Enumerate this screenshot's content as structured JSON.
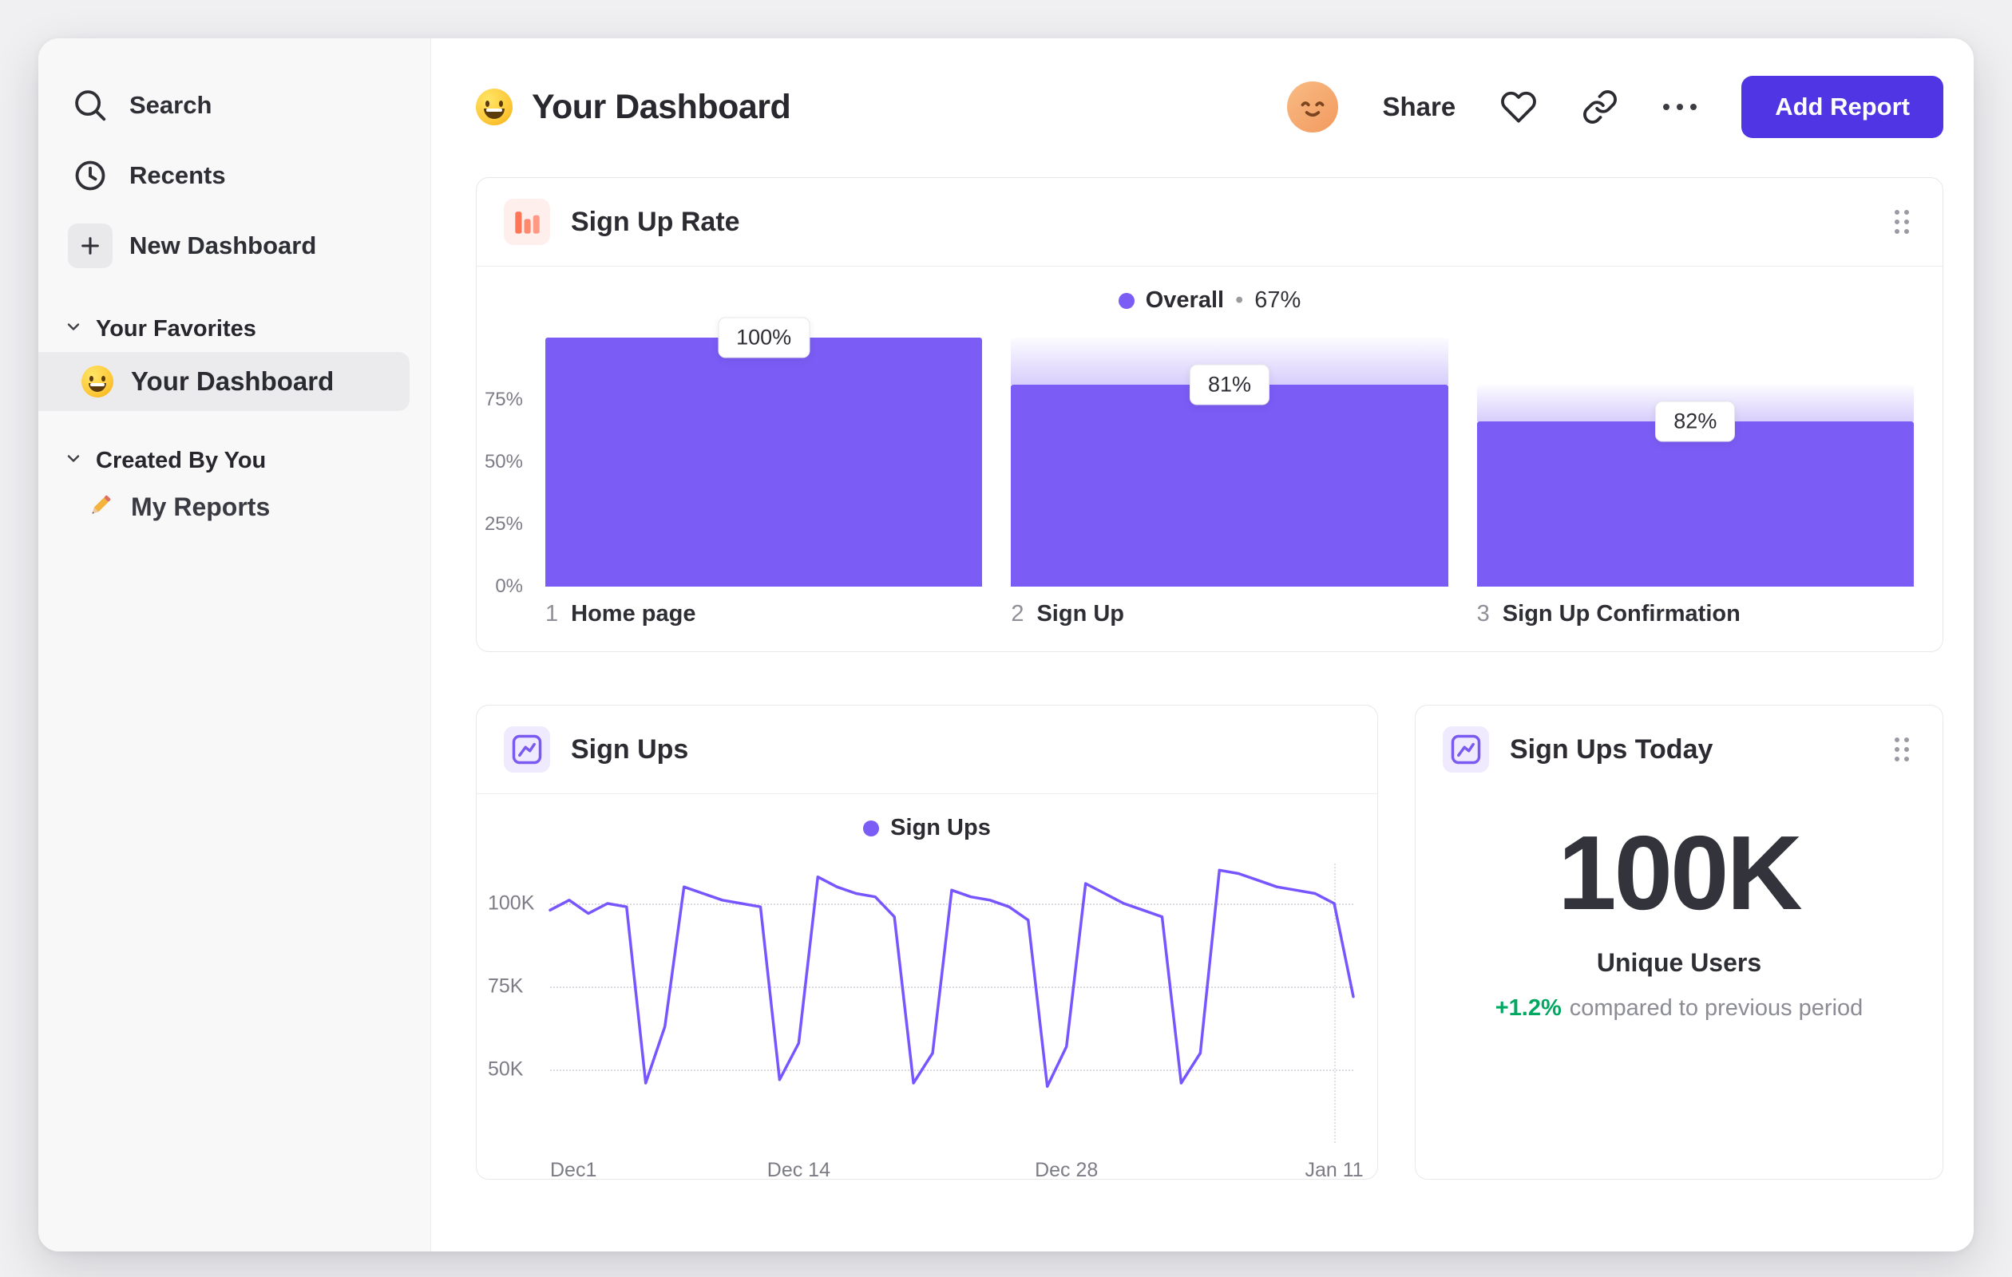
{
  "sidebar": {
    "items": [
      {
        "label": "Search",
        "icon": "search-icon"
      },
      {
        "label": "Recents",
        "icon": "clock-icon"
      },
      {
        "label": "New Dashboard",
        "icon": "plus-icon"
      }
    ],
    "sections": [
      {
        "label": "Your Favorites",
        "icon": "chevron-down-icon",
        "items": [
          {
            "label": "Your Dashboard",
            "icon": "smiley-emoji",
            "selected": true
          }
        ]
      },
      {
        "label": "Created By You",
        "icon": "chevron-down-icon",
        "items": [
          {
            "label": "My Reports",
            "icon": "pencil-emoji",
            "selected": false
          }
        ]
      }
    ]
  },
  "header": {
    "emoji": "smiley-emoji",
    "title": "Your Dashboard",
    "share_label": "Share",
    "add_report_label": "Add Report",
    "icons": [
      "avatar",
      "heart-icon",
      "link-icon",
      "more-icon"
    ]
  },
  "cards": {
    "signup_rate": {
      "icon": "bar-chart-icon",
      "title": "Sign Up Rate",
      "legend": {
        "swatch_color": "#7b5cf5",
        "label": "Overall",
        "sep": "•",
        "value": "67%"
      },
      "y_ticks": [
        "75%",
        "50%",
        "25%",
        "0%"
      ],
      "bars": [
        {
          "index": "1",
          "label": "Home page",
          "value_label": "100%",
          "height_pct": 100,
          "cap_from_pct": 100
        },
        {
          "index": "2",
          "label": "Sign Up",
          "value_label": "81%",
          "height_pct": 81,
          "cap_from_pct": 100
        },
        {
          "index": "3",
          "label": "Sign Up Confirmation",
          "value_label": "82%",
          "height_pct": 66.4,
          "cap_from_pct": 81
        }
      ]
    },
    "signups": {
      "icon": "line-chart-icon",
      "title": "Sign Ups",
      "legend": {
        "swatch_color": "#7b5cf5",
        "label": "Sign Ups"
      },
      "y_ticks": [
        "100K",
        "75K",
        "50K"
      ]
    },
    "signups_today": {
      "icon": "line-chart-icon",
      "title": "Sign Ups Today",
      "value": "100K",
      "label": "Unique Users",
      "delta": "+1.2%",
      "delta_note": "compared to previous period",
      "delta_color": "#00a862"
    }
  },
  "colors": {
    "accent_purple": "#7b5cf5",
    "line_purple": "#7856ff",
    "button_purple": "#4f35e3",
    "icon_orange": "#ff7557",
    "positive_green": "#00a862"
  },
  "chart_data": [
    {
      "type": "bar",
      "title": "Sign Up Rate",
      "subtitle": "Overall • 67%",
      "categories": [
        "Home page",
        "Sign Up",
        "Sign Up Confirmation"
      ],
      "values": [
        100,
        81,
        82
      ],
      "value_labels": [
        "100%",
        "81%",
        "82%"
      ],
      "bar_height_pct_of_axis": [
        100,
        81,
        66.4
      ],
      "yticks_pct": [
        0,
        25,
        50,
        75
      ],
      "ylim": [
        0,
        100
      ],
      "legend_position": "top-center",
      "grid": "off"
    },
    {
      "type": "line",
      "title": "Sign Ups",
      "series": [
        {
          "name": "Sign Ups",
          "values": [
            98,
            101,
            97,
            100,
            99,
            46,
            63,
            105,
            103,
            101,
            100,
            99,
            47,
            58,
            108,
            105,
            103,
            102,
            96,
            46,
            55,
            104,
            102,
            101,
            99,
            95,
            45,
            57,
            106,
            103,
            100,
            98,
            96,
            46,
            55,
            110,
            109,
            107,
            105,
            104,
            103,
            100,
            72
          ]
        }
      ],
      "x_unit": "day",
      "x_range": [
        "Dec 1",
        "Jan 12"
      ],
      "xticks": [
        {
          "label": "Dec1",
          "day": 0
        },
        {
          "label": "Dec 14",
          "day": 13
        },
        {
          "label": "Dec 28",
          "day": 27
        },
        {
          "label": "Jan 11",
          "day": 41
        }
      ],
      "ytick_values": [
        100,
        75,
        50
      ],
      "y_unit": "K",
      "ylim": [
        28,
        112
      ],
      "grid": "horizontal-dotted",
      "legend_position": "top-center",
      "marker_day": 41
    },
    {
      "type": "metric",
      "title": "Sign Ups Today",
      "value": "100K",
      "label": "Unique Users",
      "delta": "+1.2%",
      "delta_note": "compared to previous period"
    }
  ]
}
